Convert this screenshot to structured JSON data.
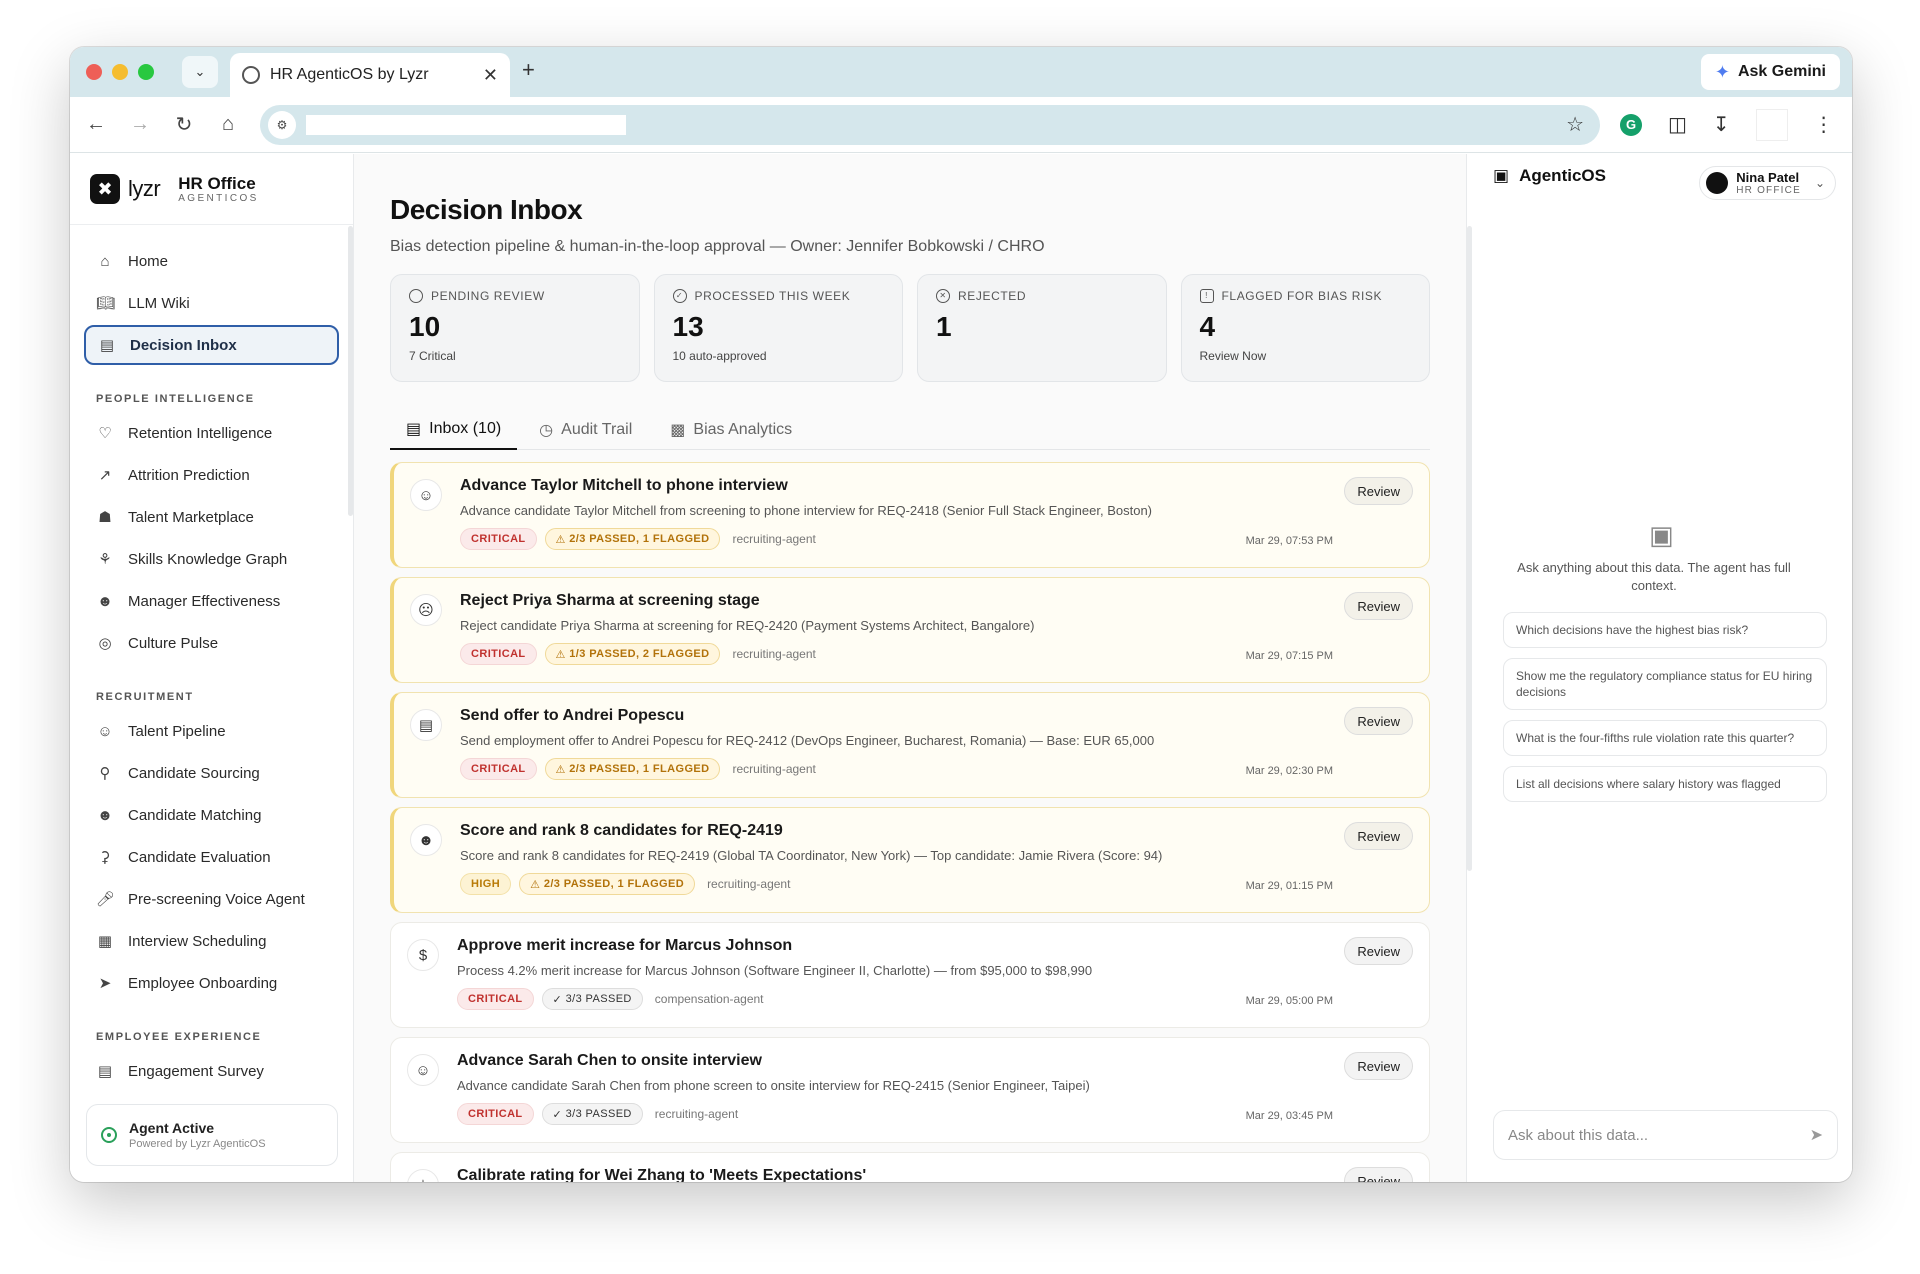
{
  "browser": {
    "tab_title": "HR AgenticOS by Lyzr",
    "gemini_label": "Ask Gemini",
    "gemini_icon": "sparkle-icon"
  },
  "brand": {
    "logo_text": "lyzr",
    "product": "HR Office",
    "product_sub": "AGENTICOS"
  },
  "sidebar": {
    "top_items": [
      {
        "label": "Home",
        "icon": "home-icon"
      },
      {
        "label": "LLM Wiki",
        "icon": "book-icon"
      },
      {
        "label": "Decision Inbox",
        "icon": "inbox-icon",
        "active": true
      }
    ],
    "sections": [
      {
        "title": "PEOPLE INTELLIGENCE",
        "items": [
          {
            "label": "Retention Intelligence"
          },
          {
            "label": "Attrition Prediction"
          },
          {
            "label": "Talent Marketplace"
          },
          {
            "label": "Skills Knowledge Graph"
          },
          {
            "label": "Manager Effectiveness"
          },
          {
            "label": "Culture Pulse"
          }
        ]
      },
      {
        "title": "RECRUITMENT",
        "items": [
          {
            "label": "Talent Pipeline"
          },
          {
            "label": "Candidate Sourcing"
          },
          {
            "label": "Candidate Matching"
          },
          {
            "label": "Candidate Evaluation"
          },
          {
            "label": "Pre-screening Voice Agent"
          },
          {
            "label": "Interview Scheduling"
          },
          {
            "label": "Employee Onboarding"
          }
        ]
      },
      {
        "title": "EMPLOYEE EXPERIENCE",
        "items": [
          {
            "label": "Engagement Survey"
          }
        ]
      }
    ],
    "agent_status": "Agent Active",
    "agent_powered": "Powered by Lyzr AgenticOS"
  },
  "main": {
    "title": "Decision Inbox",
    "subtitle": "Bias detection pipeline & human-in-the-loop approval — Owner: Jennifer Bobkowski / CHRO",
    "stats": [
      {
        "label": "PENDING REVIEW",
        "value": "10",
        "sub": "7 Critical"
      },
      {
        "label": "PROCESSED THIS WEEK",
        "value": "13",
        "sub": "10 auto-approved"
      },
      {
        "label": "REJECTED",
        "value": "1",
        "sub": ""
      },
      {
        "label": "FLAGGED FOR BIAS RISK",
        "value": "4",
        "sub": "Review Now"
      }
    ],
    "tabs": [
      {
        "label": "Inbox (10)"
      },
      {
        "label": "Audit Trail"
      },
      {
        "label": "Bias Analytics"
      }
    ],
    "review_label": "Review",
    "decisions": [
      {
        "title": "Advance Taylor Mitchell to phone interview",
        "desc": "Advance candidate Taylor Mitchell from screening to phone interview for REQ-2418 (Senior Full Stack Engineer, Boston)",
        "priority": "CRITICAL",
        "checks": "2/3 PASSED, 1 FLAGGED",
        "agent": "recruiting-agent",
        "time": "Mar 29, 07:53 PM",
        "flagged": true,
        "icon": "user-plus-icon"
      },
      {
        "title": "Reject Priya Sharma at screening stage",
        "desc": "Reject candidate Priya Sharma at screening for REQ-2420 (Payment Systems Architect, Bangalore)",
        "priority": "CRITICAL",
        "checks": "1/3 PASSED, 2 FLAGGED",
        "agent": "recruiting-agent",
        "time": "Mar 29, 07:15 PM",
        "flagged": true,
        "icon": "user-x-icon"
      },
      {
        "title": "Send offer to Andrei Popescu",
        "desc": "Send employment offer to Andrei Popescu for REQ-2412 (DevOps Engineer, Bucharest, Romania) — Base: EUR 65,000",
        "priority": "CRITICAL",
        "checks": "2/3 PASSED, 1 FLAGGED",
        "agent": "recruiting-agent",
        "time": "Mar 29, 02:30 PM",
        "flagged": true,
        "icon": "document-icon"
      },
      {
        "title": "Score and rank 8 candidates for REQ-2419",
        "desc": "Score and rank 8 candidates for REQ-2419 (Global TA Coordinator, New York) — Top candidate: Jamie Rivera (Score: 94)",
        "priority": "HIGH",
        "checks": "2/3 PASSED, 1 FLAGGED",
        "agent": "recruiting-agent",
        "time": "Mar 29, 01:15 PM",
        "flagged": true,
        "icon": "users-icon"
      },
      {
        "title": "Approve merit increase for Marcus Johnson",
        "desc": "Process 4.2% merit increase for Marcus Johnson (Software Engineer II, Charlotte) — from $95,000 to $98,990",
        "priority": "CRITICAL",
        "checks": "3/3 PASSED",
        "agent": "compensation-agent",
        "time": "Mar 29, 05:00 PM",
        "flagged": false,
        "icon": "dollar-icon"
      },
      {
        "title": "Advance Sarah Chen to onsite interview",
        "desc": "Advance candidate Sarah Chen from phone screen to onsite interview for REQ-2415 (Senior Engineer, Taipei)",
        "priority": "CRITICAL",
        "checks": "3/3 PASSED",
        "agent": "recruiting-agent",
        "time": "Mar 29, 03:45 PM",
        "flagged": false,
        "icon": "user-plus-icon"
      },
      {
        "title": "Calibrate rating for Wei Zhang to 'Meets Expectations'",
        "desc": "",
        "priority": "",
        "checks": "",
        "agent": "",
        "time": "",
        "flagged": false,
        "icon": "star-icon"
      }
    ]
  },
  "assistant": {
    "title": "AgenticOS",
    "user_name": "Nina Patel",
    "user_role": "HR OFFICE",
    "prompt": "Ask anything about this data. The agent has full context.",
    "suggestions": [
      "Which decisions have the highest bias risk?",
      "Show me the regulatory compliance status for EU hiring decisions",
      "What is the four-fifths rule violation rate this quarter?",
      "List all decisions where salary history was flagged"
    ],
    "input_placeholder": "Ask about this data..."
  }
}
